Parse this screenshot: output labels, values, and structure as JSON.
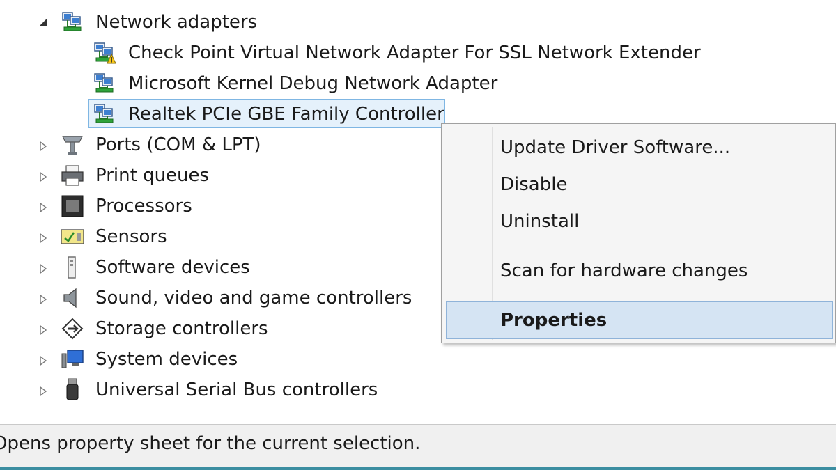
{
  "tree": {
    "parent": {
      "label": "Network adapters",
      "icon": "network-adapter-icon",
      "expanded": true
    },
    "children": [
      {
        "label": "Check Point Virtual Network Adapter For SSL Network Extender",
        "icon": "network-adapter-warning-icon"
      },
      {
        "label": "Microsoft Kernel Debug Network Adapter",
        "icon": "network-adapter-icon"
      },
      {
        "label": "Realtek PCIe GBE Family Controller",
        "icon": "network-adapter-icon",
        "selected": true
      }
    ],
    "categories": [
      {
        "label": "Ports (COM & LPT)",
        "icon": "ports-icon"
      },
      {
        "label": "Print queues",
        "icon": "printer-icon"
      },
      {
        "label": "Processors",
        "icon": "processor-icon"
      },
      {
        "label": "Sensors",
        "icon": "sensor-icon"
      },
      {
        "label": "Software devices",
        "icon": "software-device-icon"
      },
      {
        "label": "Sound, video and game controllers",
        "icon": "speaker-icon"
      },
      {
        "label": "Storage controllers",
        "icon": "storage-icon"
      },
      {
        "label": "System devices",
        "icon": "system-device-icon"
      },
      {
        "label": "Universal Serial Bus controllers",
        "icon": "usb-icon"
      }
    ]
  },
  "context_menu": {
    "items": [
      {
        "label": "Update Driver Software..."
      },
      {
        "label": "Disable"
      },
      {
        "label": "Uninstall"
      },
      {
        "label": "Scan for hardware changes"
      },
      {
        "label": "Properties",
        "highlighted": true,
        "bold": true
      }
    ]
  },
  "status_bar": {
    "text": "Opens property sheet for the current selection."
  }
}
